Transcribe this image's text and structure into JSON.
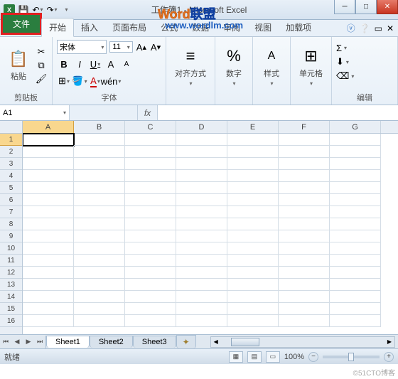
{
  "title_prefix": "工作簿1 - Microsoft Excel",
  "watermark": {
    "word": "Word",
    "union": "联盟",
    "url": "www.wordlm.com"
  },
  "tabs": {
    "file": "文件",
    "home": "开始",
    "insert": "插入",
    "layout": "页面布局",
    "formula": "公式",
    "data": "数据",
    "review": "审阅",
    "view": "视图",
    "addin": "加载项"
  },
  "ribbon": {
    "clipboard": {
      "paste": "粘贴",
      "label": "剪贴板"
    },
    "font": {
      "name": "宋体",
      "size": "11",
      "label": "字体",
      "bold": "B",
      "italic": "I",
      "underline": "U"
    },
    "align": {
      "label": "对齐方式"
    },
    "number": {
      "label": "数字",
      "pct": "%"
    },
    "style": {
      "label": "样式"
    },
    "cells": {
      "label": "单元格"
    },
    "editing": {
      "label": "编辑",
      "sigma": "Σ"
    }
  },
  "namebox": "A1",
  "fx": "fx",
  "columns": [
    "A",
    "B",
    "C",
    "D",
    "E",
    "F",
    "G"
  ],
  "rows": [
    "1",
    "2",
    "3",
    "4",
    "5",
    "6",
    "7",
    "8",
    "9",
    "10",
    "11",
    "12",
    "13",
    "14",
    "15",
    "16"
  ],
  "sheets": {
    "s1": "Sheet1",
    "s2": "Sheet2",
    "s3": "Sheet3"
  },
  "status": {
    "ready": "就绪",
    "zoom": "100%"
  },
  "credit": "©51CTO博客"
}
